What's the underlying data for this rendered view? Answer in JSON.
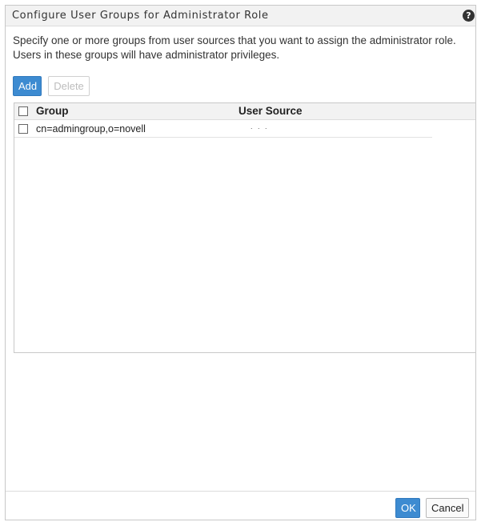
{
  "dialog": {
    "title": "Configure User Groups for Administrator Role",
    "help_icon": "help-icon",
    "help_glyph": "?",
    "description": "Specify one or more groups from user sources that you want to assign the administrator role. Users in these groups will have administrator privileges."
  },
  "toolbar": {
    "add_label": "Add",
    "delete_label": "Delete"
  },
  "table": {
    "columns": [
      "Group",
      "User Source"
    ],
    "rows": [
      {
        "group": "cn=admingroup,o=novell",
        "user_source": ". . ."
      }
    ]
  },
  "footer": {
    "ok_label": "OK",
    "cancel_label": "Cancel"
  },
  "colors": {
    "primary": "#3d8bd1",
    "title_bar": "#f2f2f2",
    "border": "#c8c8c8"
  }
}
